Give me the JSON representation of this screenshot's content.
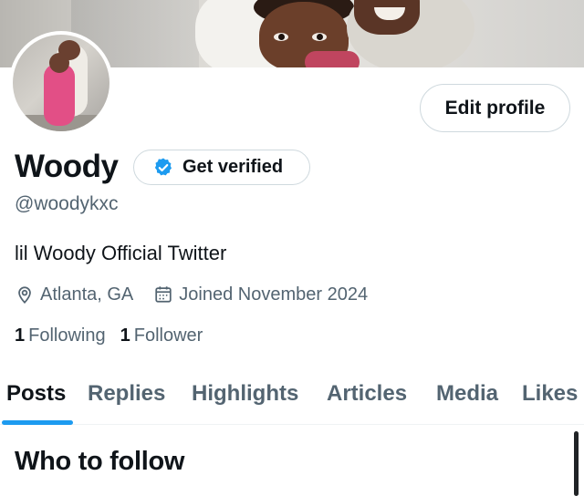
{
  "profile": {
    "display_name": "Woody",
    "handle": "@woodykxc",
    "bio": "lil Woody Official Twitter",
    "location": "Atlanta, GA",
    "joined": "Joined November 2024",
    "verify_label": "Get verified",
    "edit_label": "Edit profile"
  },
  "stats": {
    "following_count": "1",
    "following_label": "Following",
    "followers_count": "1",
    "followers_label": "Follower"
  },
  "tabs": [
    {
      "label": "Posts",
      "active": true
    },
    {
      "label": "Replies",
      "active": false
    },
    {
      "label": "Highlights",
      "active": false
    },
    {
      "label": "Articles",
      "active": false
    },
    {
      "label": "Media",
      "active": false
    },
    {
      "label": "Likes",
      "active": false
    }
  ],
  "section": {
    "who_to_follow": "Who to follow"
  },
  "icons": {
    "location": "location-pin-icon",
    "calendar": "calendar-icon",
    "verified": "verified-badge-icon"
  },
  "colors": {
    "accent": "#1d9bf0",
    "text_primary": "#0f1419",
    "text_secondary": "#536471",
    "border": "#cfd9de"
  }
}
